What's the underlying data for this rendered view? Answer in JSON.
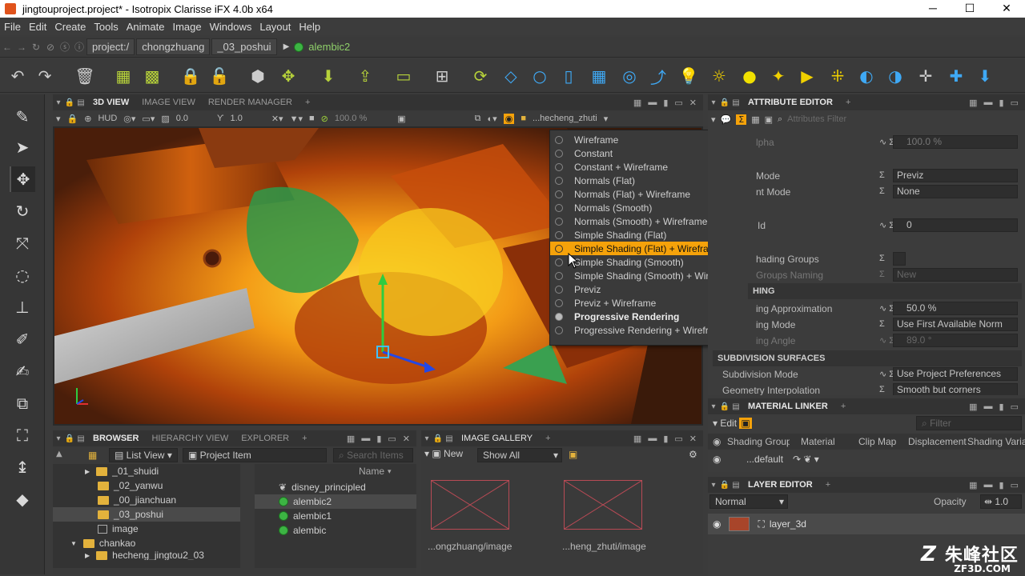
{
  "window": {
    "title": "jingtouproject.project* - Isotropix Clarisse iFX 4.0b x64",
    "minimize": "─",
    "maximize": "☐",
    "close": "✕"
  },
  "menu": [
    "File",
    "Edit",
    "Create",
    "Tools",
    "Animate",
    "Image",
    "Windows",
    "Layout",
    "Help"
  ],
  "path": {
    "segments": [
      "project:/",
      "chongzhuang",
      "_03_poshui"
    ],
    "current": "alembic2"
  },
  "viewport": {
    "tabs": {
      "view3d": "3D VIEW",
      "image_view": "IMAGE VIEW",
      "render_manager": "RENDER MANAGER"
    },
    "hud": "HUD",
    "val1": "0.0",
    "val2": "1.0",
    "pct": "100.0 %",
    "camera_path": "...hecheng_zhuti"
  },
  "shading_menu": {
    "items": [
      "Wireframe",
      "Constant",
      "Constant + Wireframe",
      "Normals (Flat)",
      "Normals (Flat) + Wireframe",
      "Normals (Smooth)",
      "Normals (Smooth) + Wireframe",
      "Simple Shading (Flat)",
      "Simple Shading (Flat) + Wireframe",
      "Simple Shading (Smooth)",
      "Simple Shading (Smooth) + Wireframe",
      "Previz",
      "Previz + Wireframe",
      "Progressive Rendering",
      "Progressive Rendering + Wireframe"
    ],
    "highlighted": "Simple Shading (Flat) + Wireframe",
    "selected": "Progressive Rendering"
  },
  "attribute_editor": {
    "title": "ATTRIBUTE EDITOR",
    "filter_placeholder": "Attributes Filter",
    "rows": [
      {
        "label": "lpha",
        "value": "100.0 %"
      },
      {
        "label": "Mode",
        "value": "Previz"
      },
      {
        "label": "nt Mode",
        "value": "None"
      },
      {
        "label": "Id",
        "value": "0"
      },
      {
        "label": "hading Groups",
        "value": ""
      },
      {
        "label": "Groups Naming",
        "value": "New"
      },
      {
        "label": "ing Approximation",
        "value": "50.0 %"
      },
      {
        "label": "ing Mode",
        "value": "Use First Available Norm"
      },
      {
        "label": "ing Angle",
        "value": "89.0 °"
      },
      {
        "label": "Subdivision Mode",
        "value": "Use Project Preferences"
      },
      {
        "label": "Geometry Interpolation",
        "value": "Smooth but corners"
      }
    ],
    "sections": {
      "hing": "HING",
      "subdiv": "SUBDIVISION SURFACES"
    }
  },
  "browser": {
    "tabs": {
      "browser": "BROWSER",
      "hierarchy": "HIERARCHY VIEW",
      "explorer": "EXPLORER"
    },
    "view_mode": "List View",
    "item_type": "Project Item",
    "search_placeholder": "Search Items",
    "name_col": "Name",
    "tree": [
      "_01_shuidi",
      "_02_yanwu",
      "_00_jianchuan",
      "_03_poshui",
      "image",
      "chankao",
      "hecheng_jingtou2_03"
    ],
    "items": [
      "disney_principled",
      "alembic2",
      "alembic1",
      "alembic"
    ]
  },
  "gallery": {
    "title": "IMAGE GALLERY",
    "new": "New",
    "show": "Show All",
    "thumbs": [
      "...ongzhuang/image",
      "...heng_zhuti/image"
    ]
  },
  "material_linker": {
    "title": "MATERIAL LINKER",
    "edit": "Edit",
    "filter_placeholder": "Filter",
    "columns": [
      "Shading Group",
      "Material",
      "Clip Map",
      "Displacement",
      "Shading Variable"
    ],
    "row": "...default"
  },
  "layer_editor": {
    "title": "LAYER EDITOR",
    "mode": "Normal",
    "opacity_label": "Opacity",
    "opacity": "1.0",
    "layer": "layer_3d"
  },
  "watermark": {
    "text": "朱峰社区",
    "url": "ZF3D.COM"
  },
  "colors": {
    "accent": "#f5a20a",
    "green": "#3cb443"
  }
}
